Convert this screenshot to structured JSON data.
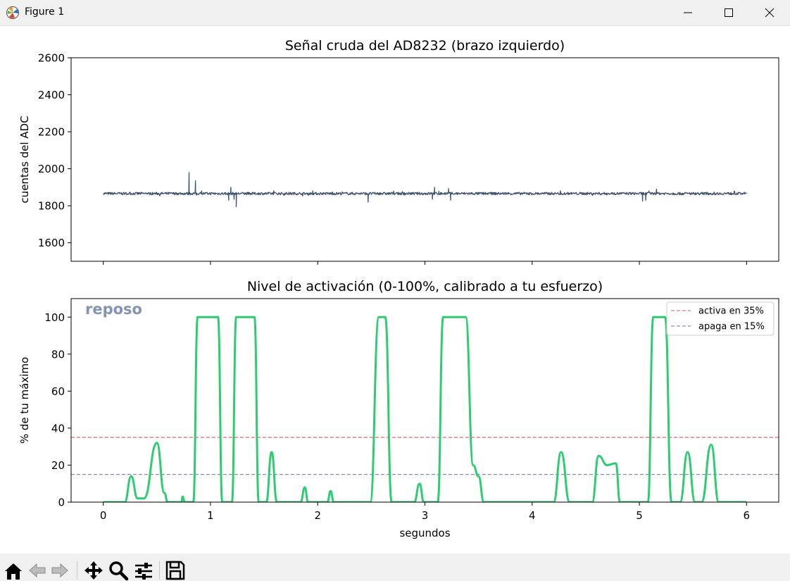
{
  "window": {
    "title": "Figure 1"
  },
  "toolbar": {
    "items": [
      "home-icon",
      "back-arrow-icon",
      "forward-arrow-icon",
      "pan-icon",
      "zoom-icon",
      "configure-subplots-icon",
      "save-icon"
    ]
  },
  "chart_data": [
    {
      "type": "line",
      "title": "Señal cruda del AD8232 (brazo izquierdo)",
      "xlabel": "",
      "ylabel": "cuentas del ADC",
      "xlim": [
        -0.3,
        6.3
      ],
      "ylim": [
        1500,
        2600
      ],
      "xticks": [
        0,
        1,
        2,
        3,
        4,
        5,
        6
      ],
      "yticks": [
        1600,
        1800,
        2000,
        2200,
        2400,
        2600
      ],
      "ytick_labels": [
        "1600",
        "1800",
        "2000",
        "2200",
        "2400",
        "2600"
      ],
      "grid": false,
      "color": "#3b5275",
      "baseline": 1866,
      "x_range": [
        0,
        6
      ],
      "spikes": [
        {
          "x": 0.8,
          "y": 1980
        },
        {
          "x": 0.81,
          "y": 1865
        },
        {
          "x": 0.86,
          "y": 1935
        },
        {
          "x": 0.87,
          "y": 1858
        },
        {
          "x": 1.17,
          "y": 1830
        },
        {
          "x": 1.19,
          "y": 1900
        },
        {
          "x": 1.22,
          "y": 1835
        },
        {
          "x": 1.24,
          "y": 1866
        },
        {
          "x": 1.24,
          "y": 1795
        },
        {
          "x": 2.47,
          "y": 1820
        },
        {
          "x": 3.07,
          "y": 1835
        },
        {
          "x": 3.09,
          "y": 1900
        },
        {
          "x": 3.13,
          "y": 1878
        },
        {
          "x": 3.22,
          "y": 1893
        },
        {
          "x": 3.24,
          "y": 1830
        },
        {
          "x": 5.03,
          "y": 1825
        },
        {
          "x": 5.06,
          "y": 1830
        },
        {
          "x": 5.09,
          "y": 1880
        },
        {
          "x": 5.16,
          "y": 1890
        }
      ]
    },
    {
      "type": "line",
      "title": "Nivel de activación (0-100%, calibrado a tu esfuerzo)",
      "xlabel": "segundos",
      "ylabel": "% de tu máximo",
      "xlim": [
        -0.3,
        6.3
      ],
      "ylim": [
        0,
        110
      ],
      "xticks": [
        0,
        1,
        2,
        3,
        4,
        5,
        6
      ],
      "xtick_labels": [
        "0",
        "1",
        "2",
        "3",
        "4",
        "5",
        "6"
      ],
      "yticks": [
        0,
        20,
        40,
        60,
        80,
        100
      ],
      "ytick_labels": [
        "0",
        "20",
        "40",
        "60",
        "80",
        "100"
      ],
      "grid": false,
      "annotation": "reposo",
      "legend": {
        "placement": "upper right",
        "entries": [
          {
            "label": "activa en 35%",
            "color": "#f27070",
            "style": "dashed"
          },
          {
            "label": "apaga en 15%",
            "color": "#8a8db5",
            "style": "dashed"
          }
        ]
      },
      "thresholds": [
        {
          "name": "activa en 35%",
          "y": 35
        },
        {
          "name": "apaga en 15%",
          "y": 15
        }
      ],
      "series": [
        {
          "color": "#2ecc71",
          "points": [
            [
              0,
              0
            ],
            [
              0.2,
              0
            ],
            [
              0.26,
              14
            ],
            [
              0.32,
              2
            ],
            [
              0.38,
              2
            ],
            [
              0.5,
              32
            ],
            [
              0.57,
              5
            ],
            [
              0.6,
              0
            ],
            [
              0.73,
              0
            ],
            [
              0.74,
              3
            ],
            [
              0.76,
              0
            ],
            [
              0.84,
              0
            ],
            [
              0.88,
              100
            ],
            [
              1.07,
              100
            ],
            [
              1.11,
              0
            ],
            [
              1.2,
              0
            ],
            [
              1.24,
              100
            ],
            [
              1.41,
              100
            ],
            [
              1.45,
              0
            ],
            [
              1.52,
              0
            ],
            [
              1.57,
              27
            ],
            [
              1.62,
              0
            ],
            [
              1.84,
              0
            ],
            [
              1.88,
              8
            ],
            [
              1.91,
              0
            ],
            [
              2.09,
              0
            ],
            [
              2.12,
              6
            ],
            [
              2.15,
              0
            ],
            [
              2.49,
              0
            ],
            [
              2.57,
              100
            ],
            [
              2.63,
              100
            ],
            [
              2.69,
              0
            ],
            [
              2.9,
              0
            ],
            [
              2.95,
              10
            ],
            [
              2.99,
              0
            ],
            [
              3.12,
              0
            ],
            [
              3.17,
              100
            ],
            [
              3.38,
              100
            ],
            [
              3.45,
              20
            ],
            [
              3.5,
              14
            ],
            [
              3.55,
              0
            ],
            [
              4.2,
              0
            ],
            [
              4.27,
              27
            ],
            [
              4.35,
              0
            ],
            [
              4.56,
              0
            ],
            [
              4.62,
              25
            ],
            [
              4.7,
              20
            ],
            [
              4.78,
              21
            ],
            [
              4.82,
              0
            ],
            [
              5.08,
              0
            ],
            [
              5.13,
              100
            ],
            [
              5.24,
              100
            ],
            [
              5.3,
              0
            ],
            [
              5.38,
              0
            ],
            [
              5.45,
              27
            ],
            [
              5.52,
              0
            ],
            [
              5.58,
              0
            ],
            [
              5.67,
              31
            ],
            [
              5.74,
              0
            ],
            [
              6,
              0
            ]
          ]
        }
      ]
    }
  ]
}
